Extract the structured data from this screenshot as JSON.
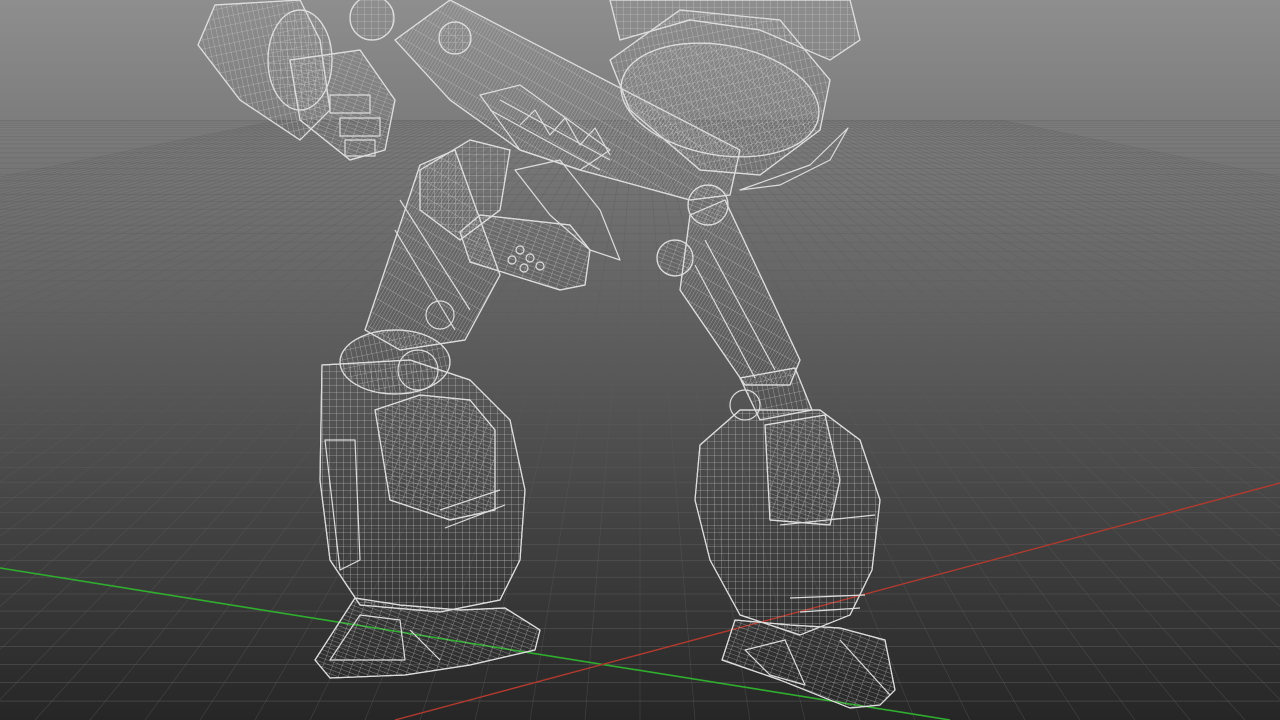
{
  "viewport": {
    "background_top": "#8e8e8e",
    "background_bottom": "#262626",
    "grid_color": "#5c5c5c",
    "axis_x_color": "#b23a2e",
    "axis_z_color": "#2fae2f",
    "wire_color": "#dcdcdc"
  },
  "model": {
    "display_mode": "wireframe",
    "subject": "robot-mech"
  }
}
